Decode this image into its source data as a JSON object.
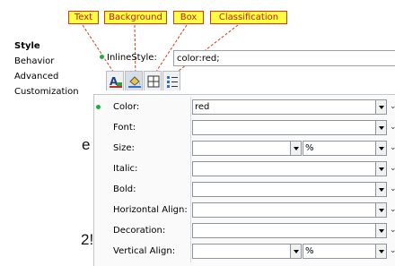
{
  "callouts": {
    "text": "Text",
    "background": "Background",
    "box": "Box",
    "classification": "Classification"
  },
  "nav": {
    "items": [
      {
        "label": "Style",
        "active": true
      },
      {
        "label": "Behavior",
        "active": false
      },
      {
        "label": "Advanced",
        "active": false
      },
      {
        "label": "Customization",
        "active": false
      }
    ]
  },
  "background_fragments": {
    "first": "e",
    "second": "2!"
  },
  "inline_style": {
    "label": "InlineStyle:",
    "value": "color:red;"
  },
  "tabs": [
    {
      "icon": "text-style-icon"
    },
    {
      "icon": "background-icon"
    },
    {
      "icon": "box-icon"
    },
    {
      "icon": "classification-icon"
    }
  ],
  "properties": [
    {
      "label": "Color:",
      "value": "red",
      "has_value": true
    },
    {
      "label": "Font:",
      "value": "",
      "has_value": false
    },
    {
      "label": "Size:",
      "value": "",
      "unit": "%",
      "has_value": false
    },
    {
      "label": "Italic:",
      "value": "",
      "has_value": false
    },
    {
      "label": "Bold:",
      "value": "",
      "has_value": false
    },
    {
      "label": "Horizontal Align:",
      "value": "",
      "has_value": false
    },
    {
      "label": "Decoration:",
      "value": "",
      "has_value": false
    },
    {
      "label": "Vertical Align:",
      "value": "",
      "unit": "%",
      "has_value": false
    }
  ],
  "colors": {
    "callout_fill": "#ffff44",
    "callout_border": "#d43a1a",
    "value_dot": "#1fae3d"
  }
}
